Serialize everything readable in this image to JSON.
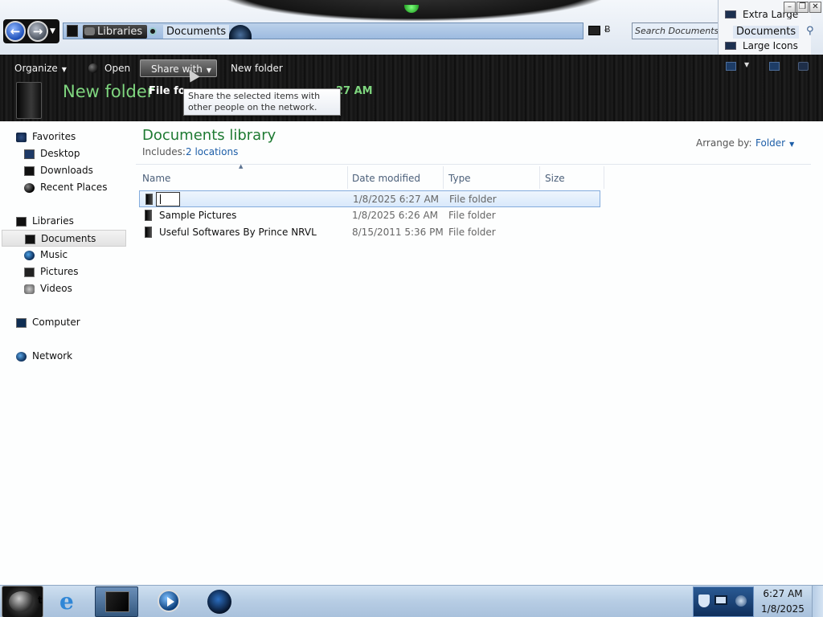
{
  "window": {
    "address": {
      "libraries": "Libraries",
      "documents": "Documents"
    },
    "search_placeholder": "Search Documents",
    "controls": {
      "minimize": "–",
      "maximize": "❐",
      "close": "✕"
    },
    "view_menu": {
      "extra_large": "Extra Large Icons",
      "current": "Documents",
      "large": "Large Icons"
    }
  },
  "commandbar": {
    "organize": "Organize",
    "open": "Open",
    "share_with": "Share with",
    "new_folder": "New folder",
    "caret": "▼"
  },
  "details_header": {
    "title": "New folder",
    "meta_label": "File fo",
    "meta_time": "27 AM"
  },
  "tooltip": "Share the selected items with other people on the network.",
  "navigation": {
    "favorites": "Favorites",
    "desktop": "Desktop",
    "downloads": "Downloads",
    "recent_places": "Recent Places",
    "libraries": "Libraries",
    "documents": "Documents",
    "music": "Music",
    "pictures": "Pictures",
    "videos": "Videos",
    "computer": "Computer",
    "network": "Network"
  },
  "library": {
    "title": "Documents library",
    "includes_label": "Includes:",
    "includes_link": "2 locations",
    "arrange_label": "Arrange by:",
    "arrange_value": "Folder"
  },
  "columns": {
    "name": "Name",
    "date": "Date modified",
    "type": "Type",
    "size": "Size"
  },
  "files": [
    {
      "name": "",
      "date": "1/8/2025 6:27 AM",
      "type": "File folder"
    },
    {
      "name": "Sample Pictures",
      "date": "1/8/2025 6:26 AM",
      "type": "File folder"
    },
    {
      "name": "Useful Softwares By Prince NRVL",
      "date": "8/15/2011 5:36 PM",
      "type": "File folder"
    }
  ],
  "taskbar": {
    "start_fragment": "t",
    "clock_time": "6:27 AM",
    "clock_date": "1/8/2025"
  }
}
